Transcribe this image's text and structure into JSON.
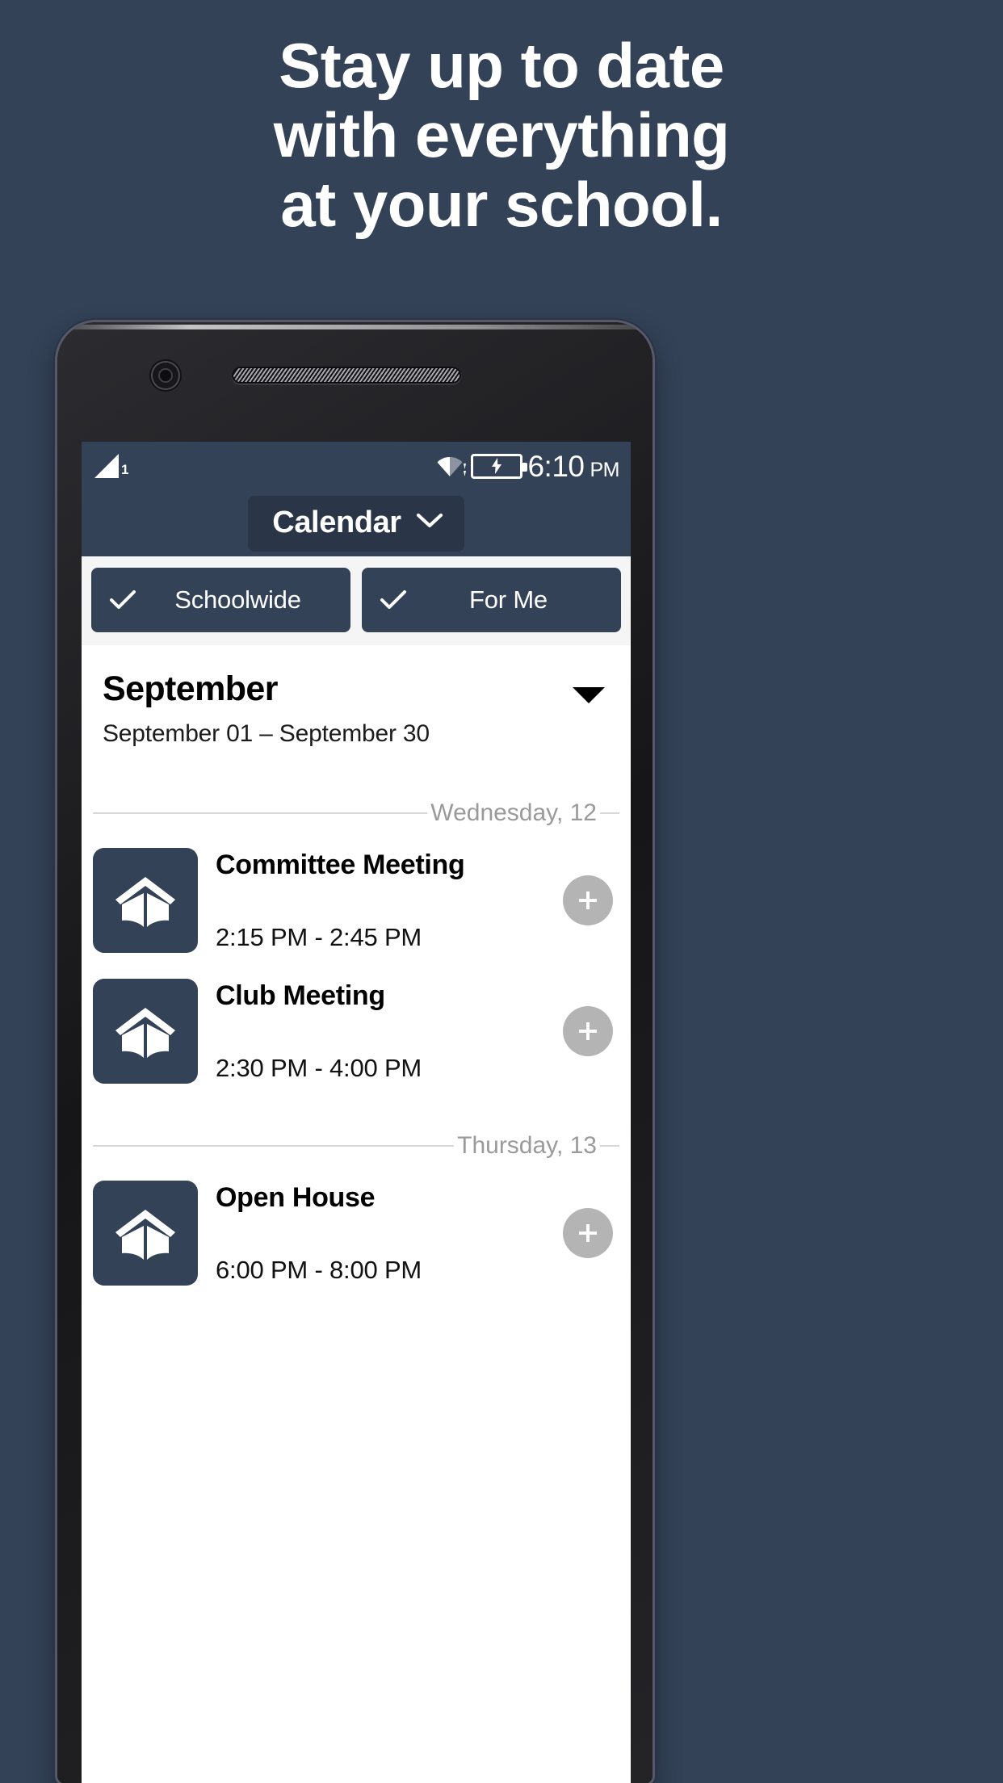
{
  "promo": {
    "headline_lines": [
      "Stay up to date",
      "with everything",
      "at your school."
    ],
    "background_color": "#334257"
  },
  "status_bar": {
    "signal_icon": "signal-triangle-icon",
    "sim_number": "1",
    "wifi_icon": "wifi-icon",
    "battery_icon": "battery-charging-icon",
    "time": "6:10",
    "meridiem": "PM"
  },
  "app_bar": {
    "title": "Calendar",
    "dropdown_icon": "chevron-down-icon"
  },
  "filters": [
    {
      "label": "Schoolwide",
      "checked": true,
      "icon": "check-icon"
    },
    {
      "label": "For Me",
      "checked": true,
      "icon": "check-icon"
    }
  ],
  "month": {
    "title": "September",
    "range": "September 01 – September 30",
    "expand_icon": "caret-down-icon"
  },
  "days": [
    {
      "label": "Wednesday, 12",
      "events": [
        {
          "title": "Committee Meeting",
          "time": "2:15 PM - 2:45 PM",
          "icon": "school-book-icon",
          "add_icon": "plus-icon"
        },
        {
          "title": "Club Meeting",
          "time": "2:30 PM - 4:00 PM",
          "icon": "school-book-icon",
          "add_icon": "plus-icon"
        }
      ]
    },
    {
      "label": "Thursday, 13",
      "events": [
        {
          "title": "Open House",
          "time": "6:00 PM - 8:00 PM",
          "icon": "school-book-icon",
          "add_icon": "plus-icon"
        }
      ]
    }
  ],
  "colors": {
    "brand": "#334257",
    "app_bar_pill": "#2a3647",
    "filter_strip": "#f5f5f5",
    "plus_button": "#b4b4b4",
    "divider": "#d7d7d7",
    "divider_text": "#9a9a9a"
  }
}
